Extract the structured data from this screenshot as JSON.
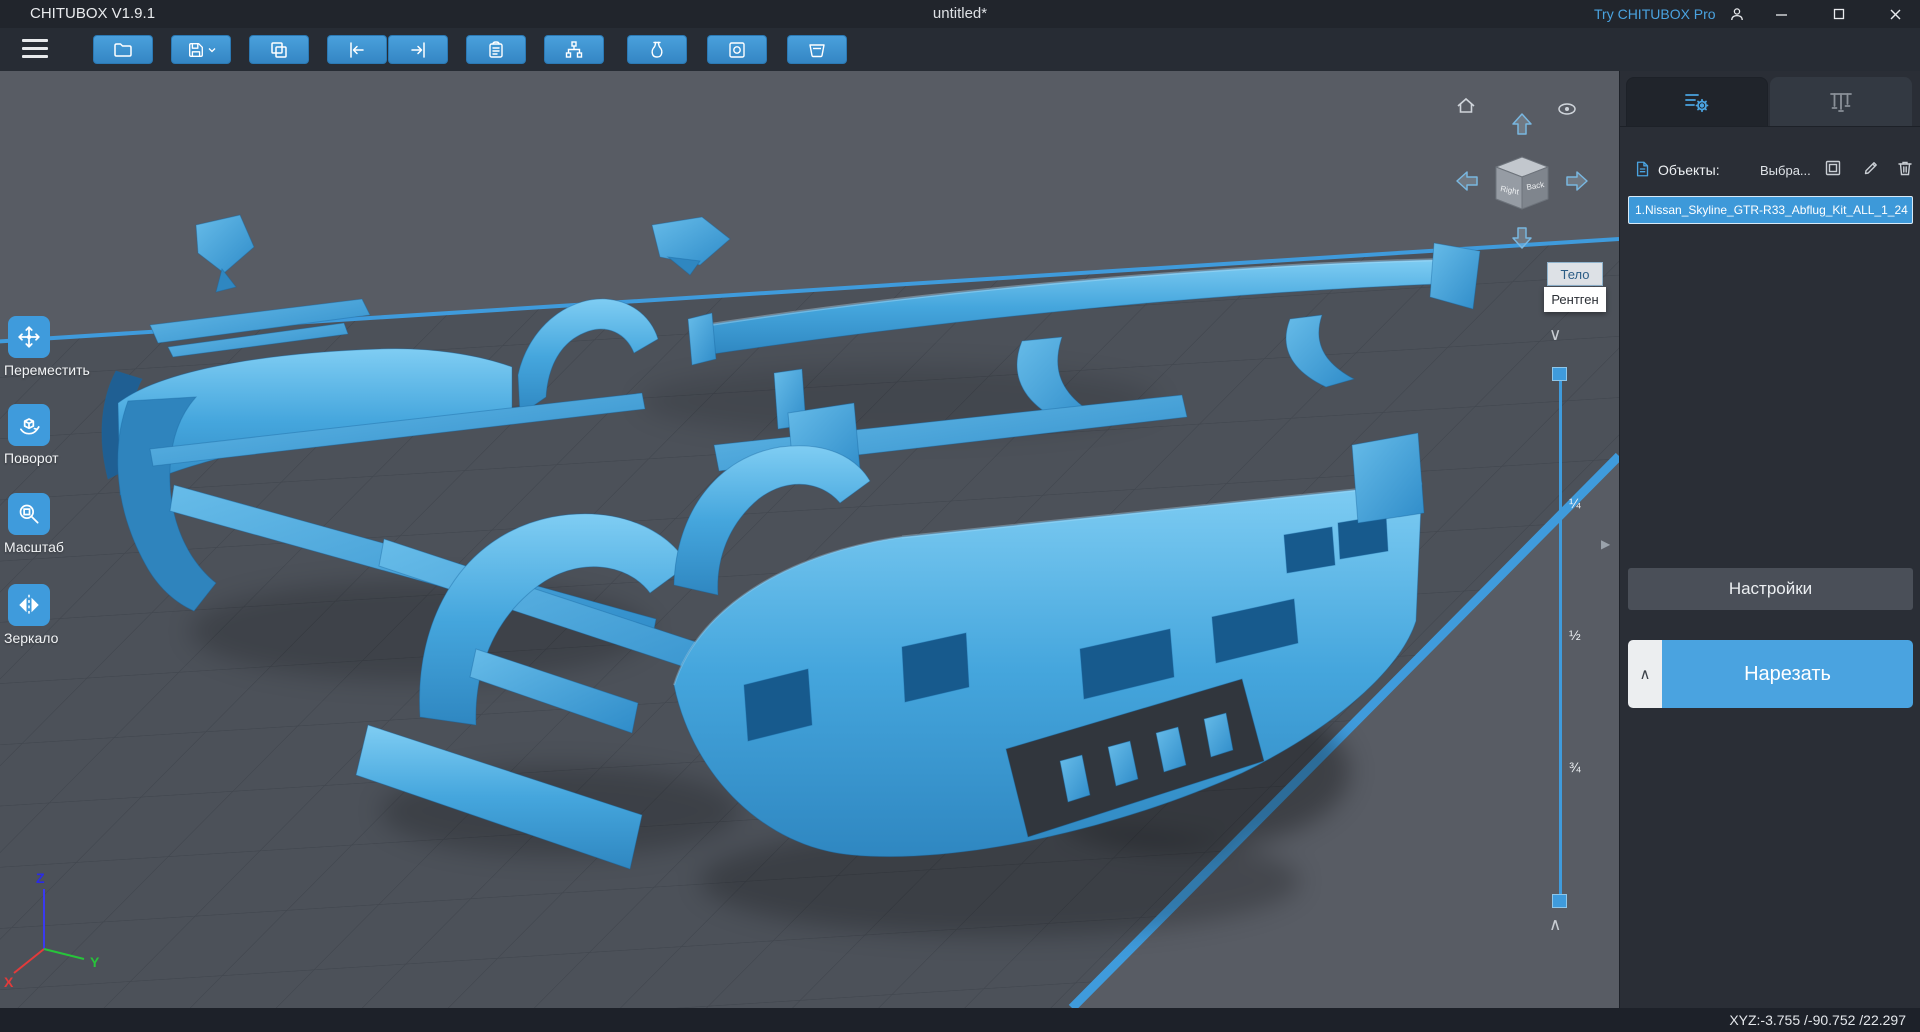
{
  "window": {
    "app_title": "CHITUBOX V1.9.1",
    "document_title": "untitled*",
    "pro_link": "Try CHITUBOX Pro"
  },
  "toolbar": {
    "buttons": [
      "open-file",
      "save",
      "copy",
      "undo",
      "redo",
      "clipboard",
      "auto-arrange",
      "hollow",
      "dig-hole",
      "resin-tank"
    ]
  },
  "left_tools": {
    "items": [
      {
        "label": "Переместить",
        "icon": "move-icon"
      },
      {
        "label": "Поворот",
        "icon": "rotate-icon"
      },
      {
        "label": "Масштаб",
        "icon": "scale-icon"
      },
      {
        "label": "Зеркало",
        "icon": "mirror-icon"
      }
    ]
  },
  "viewport": {
    "view_cube": {
      "right_face": "Right",
      "back_face": "Back"
    },
    "render_mode": {
      "selected": "Тело",
      "option": "Рентген"
    },
    "clip_slider": {
      "labels": [
        "¼",
        "½",
        "¾"
      ]
    },
    "axes": {
      "x": "X",
      "y": "Y",
      "z": "Z"
    }
  },
  "right_panel": {
    "objects_label": "Объекты:",
    "select_label": "Выбра...",
    "object_item": "1.Nissan_Skyline_GTR-R33_Abflug_Kit_ALL_1_24",
    "settings_button": "Настройки",
    "slice_button": "Нарезать"
  },
  "status_bar": {
    "coordinates": "XYZ:-3.755 /-90.752 /22.297"
  },
  "icons": {
    "chevron_down": "∨",
    "chevron_up": "∧",
    "collapse_right": "▶"
  },
  "colors": {
    "accent": "#3f9bdc",
    "model_blue": "#45a6dd",
    "viewport_bg": "#585c64",
    "panel_bg": "#2a2e36",
    "titlebar_bg": "#21252c",
    "toolbar_bg": "#272c34",
    "statusbar_bg": "#1d2129",
    "slice_button": "#4aa3e0",
    "selected_item": "#3d99d9"
  }
}
